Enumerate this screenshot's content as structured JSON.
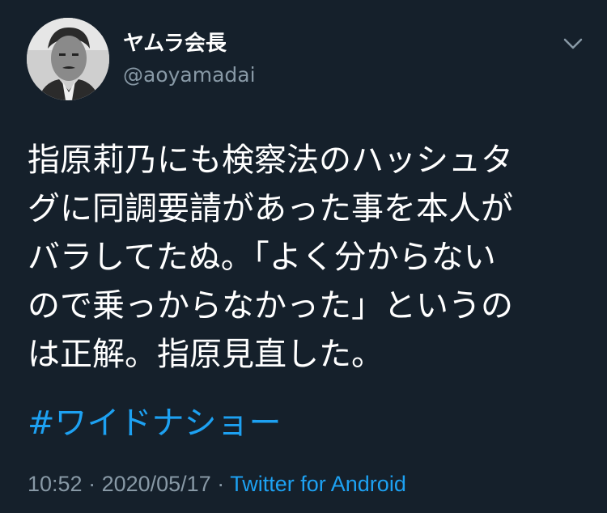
{
  "user": {
    "display_name": "ヤムラ会長",
    "handle": "@aoyamadai"
  },
  "tweet": {
    "lines": [
      "指原莉乃にも検察法のハッシュタ",
      "グに同調要請があった事を本人が",
      "バラしてたぬ。「よく分からない",
      "ので乗っからなかった」というの",
      "は正解。指原見直した。"
    ],
    "hashtag": "#ワイドナショー"
  },
  "meta": {
    "time": "10:52",
    "separator1": " · ",
    "date": "2020/05/17",
    "separator2": " · ",
    "source": "Twitter for Android"
  },
  "icons": {
    "caret": "chevron-down-icon",
    "avatar": "user-avatar"
  },
  "colors": {
    "background": "#15202b",
    "text": "#ffffff",
    "secondary": "#8899a6",
    "link": "#1da1f2"
  }
}
